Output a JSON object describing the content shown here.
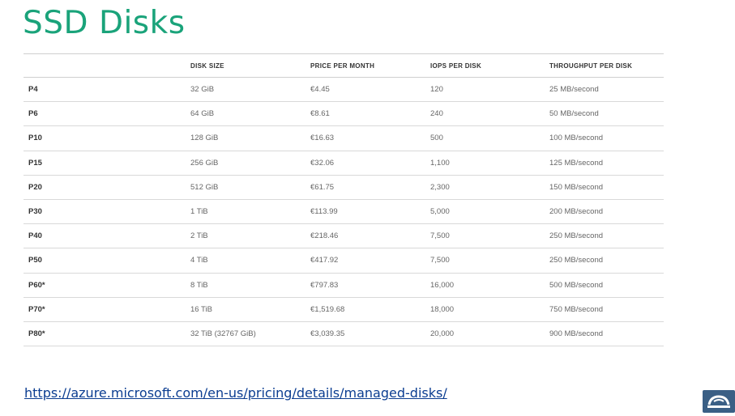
{
  "title": "SSD Disks",
  "table": {
    "headers": [
      "",
      "DISK SIZE",
      "PRICE PER MONTH",
      "IOPS PER DISK",
      "THROUGHPUT PER DISK"
    ],
    "rows": [
      [
        "P4",
        "32 GiB",
        "€4.45",
        "120",
        "25 MB/second"
      ],
      [
        "P6",
        "64 GiB",
        "€8.61",
        "240",
        "50 MB/second"
      ],
      [
        "P10",
        "128 GiB",
        "€16.63",
        "500",
        "100 MB/second"
      ],
      [
        "P15",
        "256 GiB",
        "€32.06",
        "1,100",
        "125 MB/second"
      ],
      [
        "P20",
        "512 GiB",
        "€61.75",
        "2,300",
        "150 MB/second"
      ],
      [
        "P30",
        "1 TiB",
        "€113.99",
        "5,000",
        "200 MB/second"
      ],
      [
        "P40",
        "2 TiB",
        "€218.46",
        "7,500",
        "250 MB/second"
      ],
      [
        "P50",
        "4 TiB",
        "€417.92",
        "7,500",
        "250 MB/second"
      ],
      [
        "P60*",
        "8 TiB",
        "€797.83",
        "16,000",
        "500 MB/second"
      ],
      [
        "P70*",
        "16 TiB",
        "€1,519.68",
        "18,000",
        "750 MB/second"
      ],
      [
        "P80*",
        "32 TiB (32767 GiB)",
        "€3,039.35",
        "20,000",
        "900 MB/second"
      ]
    ]
  },
  "link": "https://azure.microsoft.com/en-us/pricing/details/managed-disks/",
  "logo_icon": "cloud-logo-icon",
  "colors": {
    "title": "#1aa37a",
    "link": "#0b3d91",
    "logo": "#3a5f85"
  }
}
